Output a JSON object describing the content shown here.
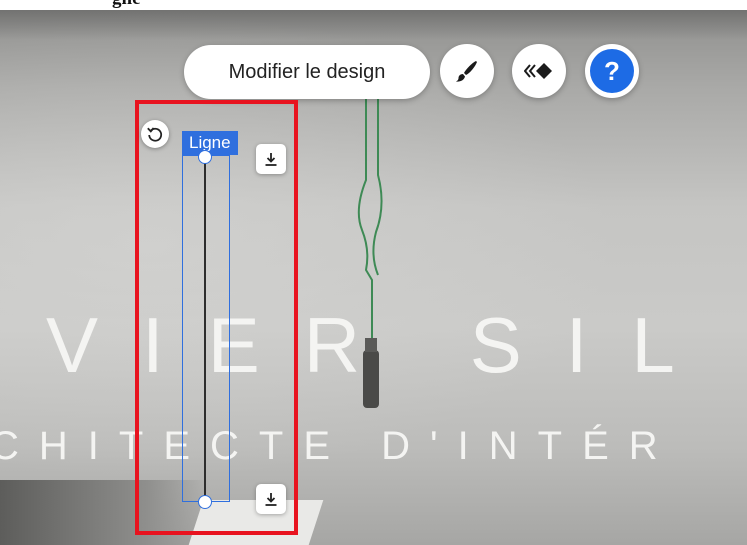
{
  "caption": {
    "fragment": "gne"
  },
  "hero": {
    "title": "VIER SIL",
    "subtitle": "CHITECTE D'INTÉR"
  },
  "toolbar": {
    "edit_design_label": "Modifier le design",
    "paint_icon": "paint-brush-icon",
    "animation_icon": "animation-icon",
    "help_symbol": "?",
    "help_color": "#1d6be5"
  },
  "selection": {
    "element_label": "Ligne",
    "frame_color": "#2f6fde",
    "highlight_color": "#e8131f"
  }
}
